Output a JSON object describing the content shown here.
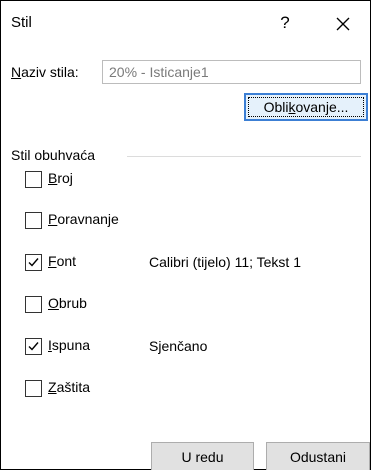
{
  "window": {
    "title": "Stil",
    "help_label": "?"
  },
  "style_name": {
    "label_ul": "N",
    "label_rest": "aziv stila:",
    "value": "20% - Isticanje1"
  },
  "format_button": {
    "pre": "Obli",
    "ul": "k",
    "post": "ovanje..."
  },
  "group": {
    "label": "Stil obuhvaća",
    "items": [
      {
        "ul": "B",
        "rest": "roj",
        "checked": false,
        "description": ""
      },
      {
        "ul": "P",
        "rest": "oravnanje",
        "checked": false,
        "description": ""
      },
      {
        "ul": "F",
        "rest": "ont",
        "checked": true,
        "description": "Calibri (tijelo) 11; Tekst 1"
      },
      {
        "ul": "O",
        "rest": "brub",
        "checked": false,
        "description": ""
      },
      {
        "ul": "I",
        "rest": "spuna",
        "checked": true,
        "description": "Sjenčano"
      },
      {
        "ul": "Z",
        "rest": "aštita",
        "checked": false,
        "description": ""
      }
    ]
  },
  "buttons": {
    "ok": "U redu",
    "cancel": "Odustani"
  }
}
